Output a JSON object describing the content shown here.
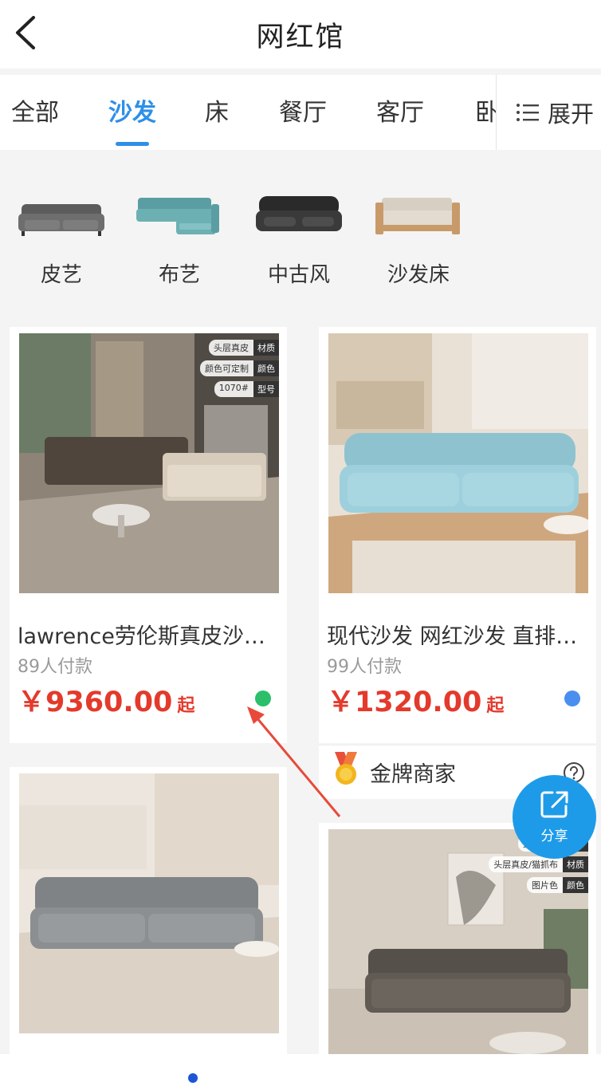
{
  "header": {
    "title": "网红馆"
  },
  "tabs": [
    {
      "label": "全部"
    },
    {
      "label": "沙发"
    },
    {
      "label": "床"
    },
    {
      "label": "餐厅"
    },
    {
      "label": "客厅"
    },
    {
      "label": "卧"
    }
  ],
  "active_tab": "沙发",
  "expand_label": "展开",
  "subcategories": [
    {
      "label": "皮艺"
    },
    {
      "label": "布艺"
    },
    {
      "label": "中古风"
    },
    {
      "label": "沙发床"
    }
  ],
  "products": [
    {
      "title": "lawrence劳伦斯真皮沙…",
      "sales": "89人付款",
      "price": "￥9360.00",
      "price_suffix": "起",
      "dot_color": "#2bbf6a",
      "badges": [
        {
          "value": "头层真皮",
          "key": "材质"
        },
        {
          "value": "颜色可定制",
          "key": "颜色"
        },
        {
          "value": "1070#",
          "key": "型号"
        }
      ]
    },
    {
      "title": "现代沙发 网红沙发 直排…",
      "sales": "99人付款",
      "price": "￥1320.00",
      "price_suffix": "起",
      "dot_color": "#4a8ff0"
    },
    {
      "title": "",
      "sales": ""
    },
    {
      "title": "",
      "badges": [
        {
          "value": "直排沙发",
          "key": "型号"
        },
        {
          "value": "头层真皮/猫抓布",
          "key": "材质"
        },
        {
          "value": "图片色",
          "key": "颜色"
        }
      ]
    }
  ],
  "merchant_label": "金牌商家",
  "share_label": "分享",
  "colors": {
    "accent": "#2e8fe8",
    "price": "#e33a2c",
    "share": "#1e9be8",
    "annotation_arrow": "#e8493a"
  }
}
